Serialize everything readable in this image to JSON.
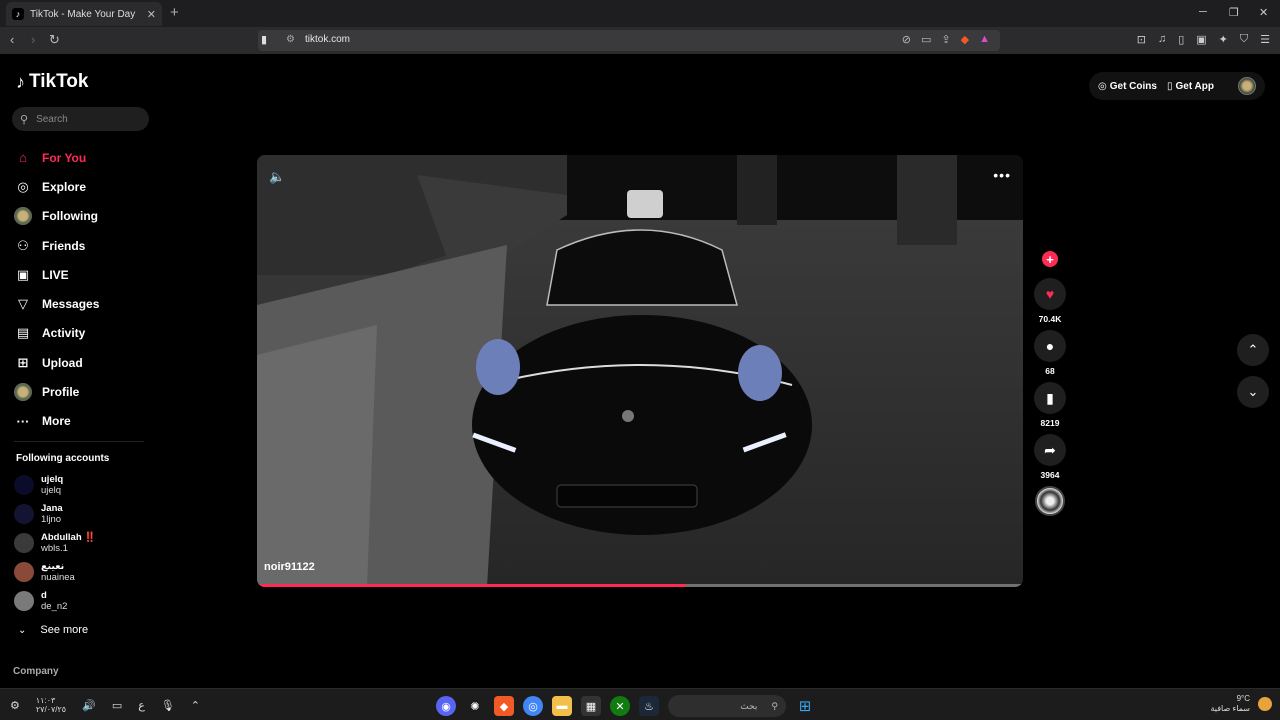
{
  "browser": {
    "tab_title": "TikTok - Make Your Day",
    "tab_favicon": "♪",
    "new_tab_label": "+",
    "url": "tiktok.com",
    "controls": {
      "minimize": "─",
      "maximize": "❐",
      "close": "✕",
      "back": "‹",
      "forward": "›",
      "reload": "↻",
      "tab_close": "✕"
    }
  },
  "logo": {
    "mark": "♪",
    "text": "TikTok"
  },
  "search": {
    "placeholder": "Search"
  },
  "nav": {
    "items": [
      {
        "label": "For You",
        "icon": "⌂",
        "active": true
      },
      {
        "label": "Explore",
        "icon": "◎"
      },
      {
        "label": "Following",
        "icon": "avatar"
      },
      {
        "label": "Friends",
        "icon": "⚇"
      },
      {
        "label": "LIVE",
        "icon": "▣"
      },
      {
        "label": "Messages",
        "icon": "▽"
      },
      {
        "label": "Activity",
        "icon": "▤"
      },
      {
        "label": "Upload",
        "icon": "⊞"
      },
      {
        "label": "Profile",
        "icon": "avatar"
      },
      {
        "label": "More",
        "icon": "···"
      }
    ]
  },
  "following_accounts": {
    "title": "Following accounts",
    "accounts": [
      {
        "name": "ujelq",
        "username": "ujelq",
        "avatar_color": "#0b0b2a"
      },
      {
        "name": "Jana",
        "username": "1ljno",
        "avatar_color": "#141432"
      },
      {
        "name": "Abdullah ‼️",
        "username": "wbls.1",
        "avatar_color": "#3a3a3a"
      },
      {
        "name": "نعينع",
        "username": "nuainea",
        "avatar_color": "#8a4a3a"
      },
      {
        "name": "d",
        "username": "de_n2",
        "avatar_color": "#7a7a7a"
      }
    ],
    "see_more": "See more"
  },
  "footer": {
    "company": "Company"
  },
  "topbar": {
    "get_coins": "Get Coins",
    "get_app": "Get App"
  },
  "video": {
    "author": "noir91122",
    "progress": 0.56,
    "more_icon": "•••",
    "mute_icon": "🔈"
  },
  "actions": {
    "likes": "70.4K",
    "comments": "68",
    "saves": "8219",
    "shares": "3964"
  },
  "taskbar": {
    "time": "١١:٠٣",
    "date": "٢٧/٠٧/٢٥",
    "lang": "ع",
    "search_text": "بحث",
    "temp": "9°C",
    "weather": "سماء صافية"
  },
  "colors": {
    "accent": "#fe2c55",
    "background": "#000000"
  }
}
